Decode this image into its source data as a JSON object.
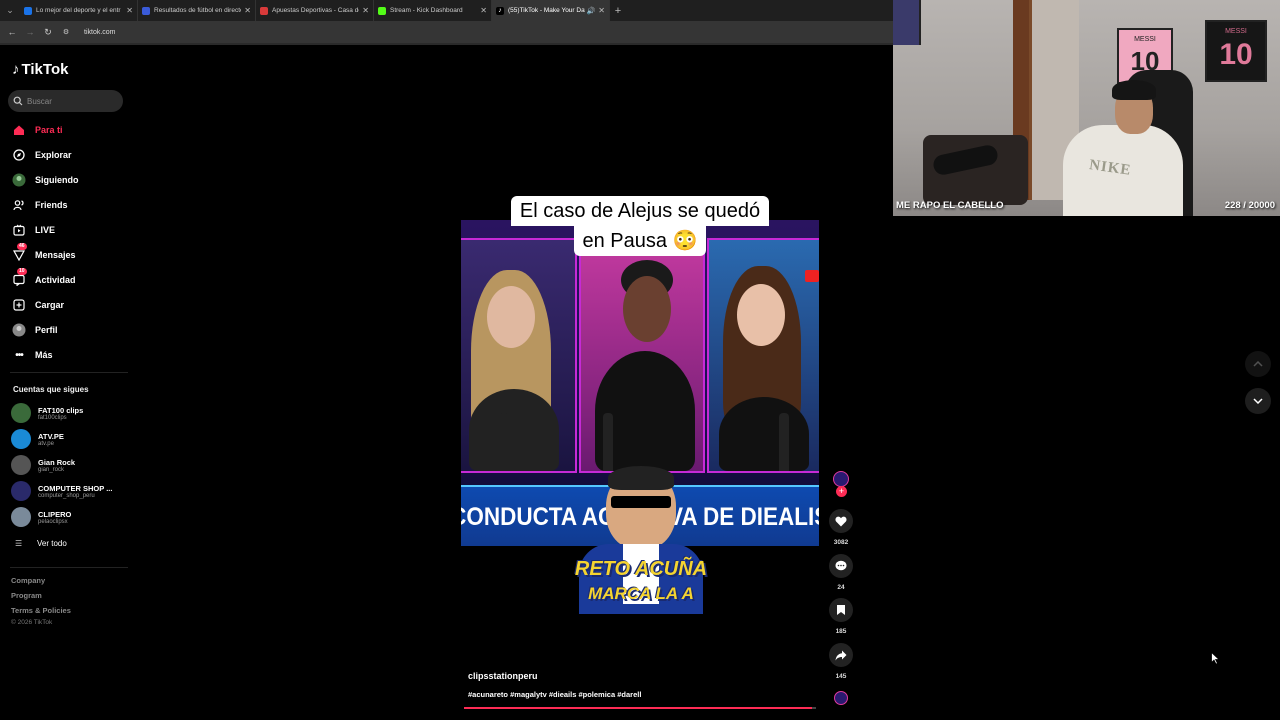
{
  "browser": {
    "tabs": [
      {
        "title": "Lo mejor del deporte y el entr",
        "favicon_color": "#1a73e8",
        "active": false
      },
      {
        "title": "Resultados de fútbol en directo",
        "favicon_color": "#3a5bd9",
        "active": false
      },
      {
        "title": "Apuestas Deportivas - Casa de",
        "favicon_color": "#d93a3a",
        "active": false
      },
      {
        "title": "Stream - Kick Dashboard",
        "favicon_color": "#53fc18",
        "active": false
      },
      {
        "title": "(55)TikTok - Make Your Day",
        "favicon_color": "#ffffff",
        "active": true
      }
    ],
    "url": "tiktok.com"
  },
  "sidebar": {
    "logo": "TikTok",
    "search_placeholder": "Buscar",
    "nav": [
      {
        "label": "Para ti",
        "icon": "home-icon",
        "active": true
      },
      {
        "label": "Explorar",
        "icon": "compass-icon"
      },
      {
        "label": "Siguiendo",
        "icon": "following-icon"
      },
      {
        "label": "Friends",
        "icon": "friends-icon"
      },
      {
        "label": "LIVE",
        "icon": "live-icon"
      },
      {
        "label": "Mensajes",
        "icon": "messages-icon",
        "badge": "46"
      },
      {
        "label": "Actividad",
        "icon": "activity-icon",
        "badge": "10"
      },
      {
        "label": "Cargar",
        "icon": "upload-icon"
      },
      {
        "label": "Perfil",
        "icon": "profile-icon"
      },
      {
        "label": "Más",
        "icon": "more-icon"
      }
    ],
    "following_title": "Cuentas que sigues",
    "accounts": [
      {
        "name": "FAT100 clips",
        "handle": "fat100clips",
        "color": "#3a6a3a"
      },
      {
        "name": "ATV.PE",
        "handle": "atv.pe",
        "color": "#1a8ad6"
      },
      {
        "name": "Gian Rock",
        "handle": "gian_rock",
        "color": "#555555"
      },
      {
        "name": "COMPUTER SHOP ...",
        "handle": "computer_shop_peru",
        "color": "#2a2a6a"
      },
      {
        "name": "CLIPERO",
        "handle": "pelaoclipsx",
        "color": "#7a8a9a"
      }
    ],
    "see_all": "Ver todo",
    "footer": [
      "Company",
      "Program",
      "Terms & Policies"
    ],
    "copyright": "© 2026 TikTok"
  },
  "video": {
    "caption_line1": "El caso de Alejus se quedó",
    "caption_line2": "en Pausa 😳",
    "lower_third": "CONDUCTA AGRESIVA DE DIEALIS",
    "reto_line1": "RETO ACUÑA",
    "reto_line2": "MARCA LA A",
    "author": "clipsstationperu",
    "hashtags": "#acunareto #magalytv #dieails #polemica #darell",
    "progress": 0.99
  },
  "actions": {
    "likes": "3082",
    "comments": "24",
    "saves": "185",
    "shares": "145"
  },
  "webcam": {
    "label": "ME RAPO EL CABELLO",
    "count": "228 / 20000",
    "frame1_small": "MESSI",
    "frame1_big": "10",
    "frame2_small": "MESSI",
    "frame2_big": "10",
    "shirt_text": "NIKE"
  },
  "colors": {
    "accent": "#fe2c55",
    "background": "#000000"
  }
}
